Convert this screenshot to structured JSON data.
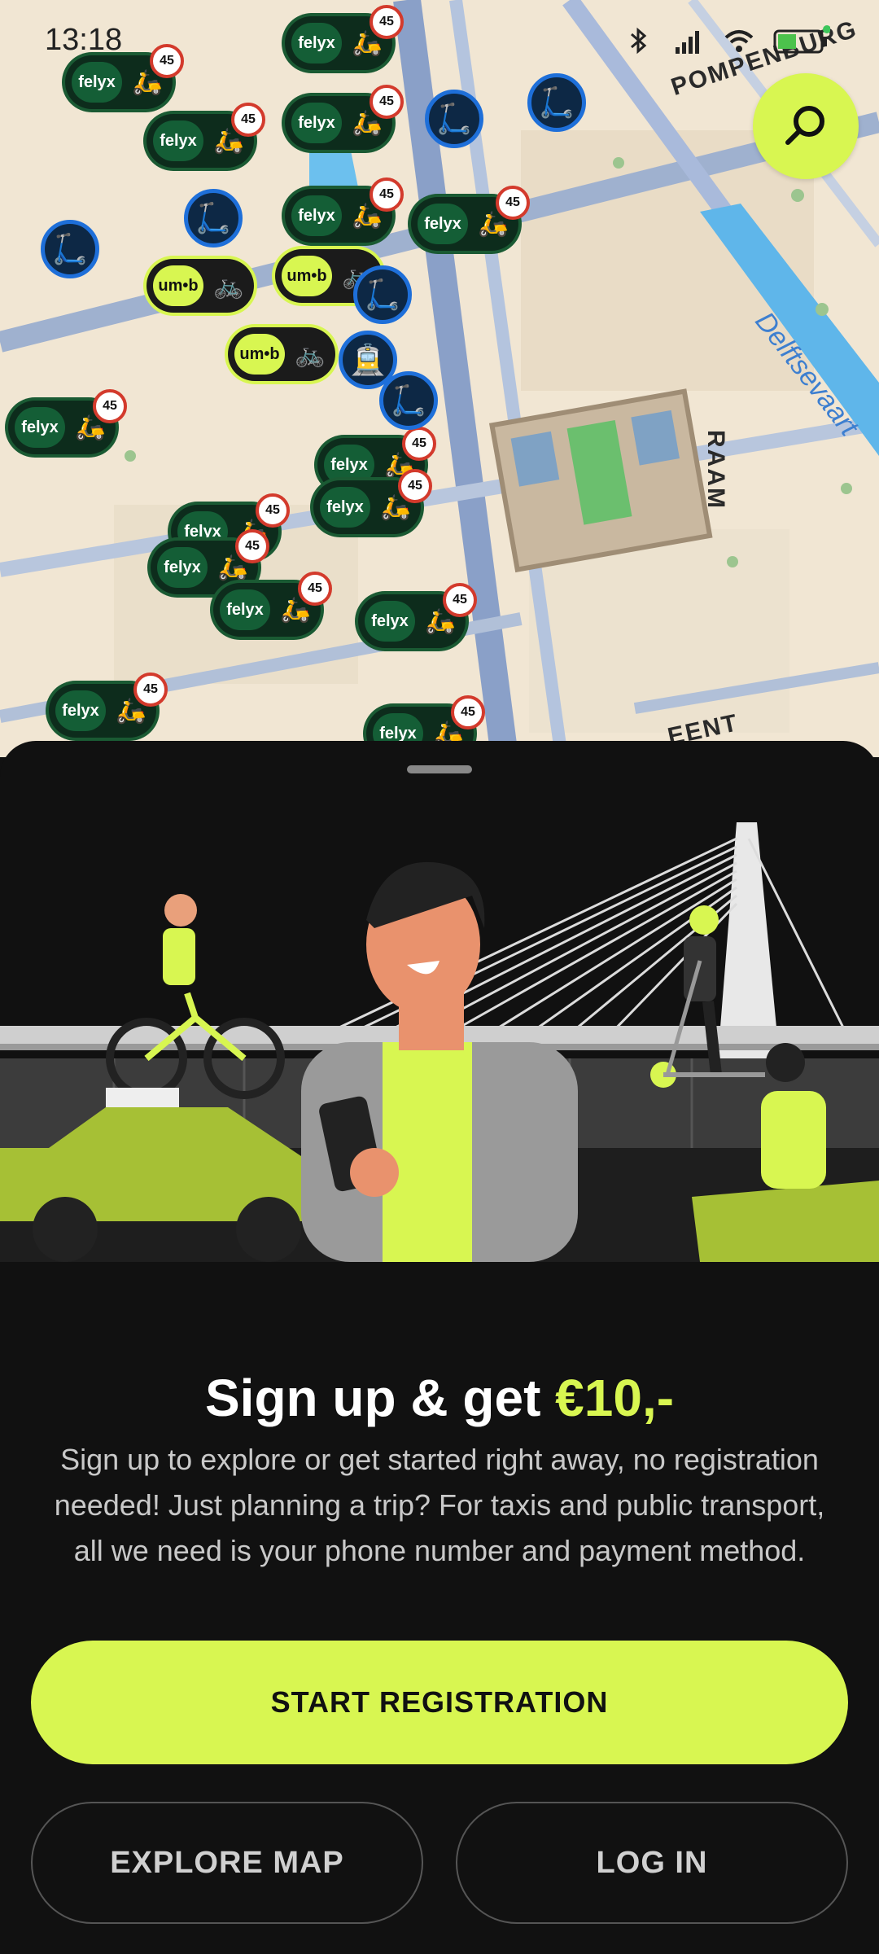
{
  "status_bar": {
    "time": "13:18",
    "icons": [
      "telegram-icon",
      "more-icon",
      "bluetooth-icon",
      "signal-icon",
      "wifi-icon",
      "battery-icon"
    ],
    "battery_level": "40"
  },
  "map": {
    "street_labels": [
      "POMPENBURG",
      "RAAM",
      "EENT"
    ],
    "water_label": "Delftsevaart",
    "providers": [
      "felyx",
      "um•b"
    ],
    "speed_badge": "45",
    "search_icon": "search-icon"
  },
  "sheet": {
    "headline_main": "Sign up & get ",
    "headline_accent": "€10,-",
    "description": "Sign up to explore or get started right away, no registration needed! Just planning a trip? For taxis and public transport, all we need is your phone number and payment method.",
    "primary_button": "START REGISTRATION",
    "secondary_button": "EXPLORE MAP",
    "tertiary_button": "LOG IN"
  },
  "colors": {
    "accent": "#d8f651",
    "felyx_green": "#145e36",
    "sheet_bg": "#111111"
  }
}
